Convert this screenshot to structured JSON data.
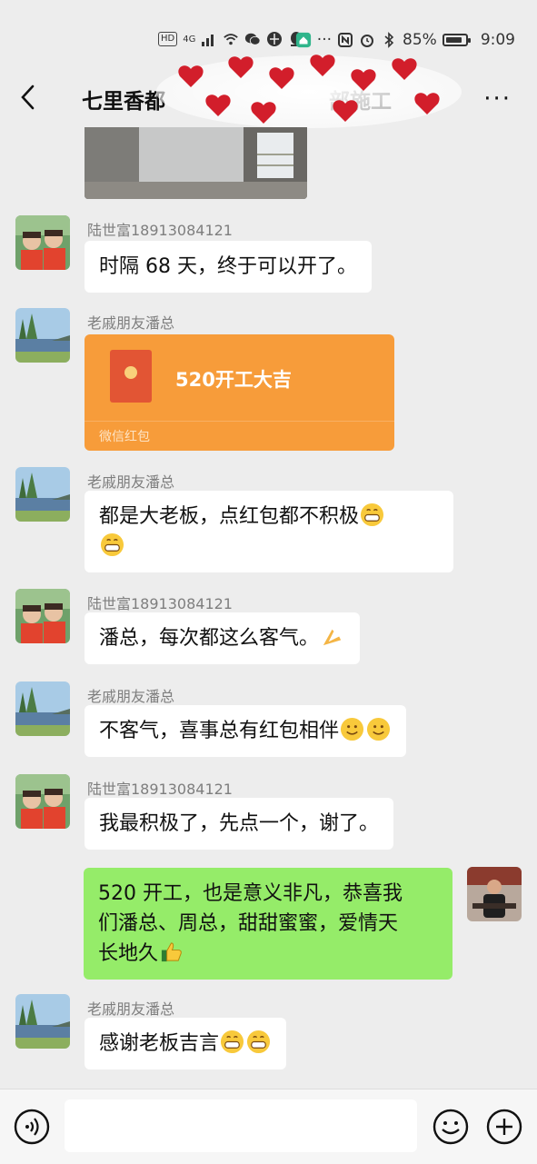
{
  "status_bar": {
    "network": "4G",
    "hd": "HD",
    "battery_percent": "85%",
    "battery_level": 0.85,
    "time": "9:09"
  },
  "nav": {
    "title": "七里香都",
    "title_tail": "部施工",
    "back_icon": "chevron-left-icon",
    "more_icon": "more-dots-icon"
  },
  "messages": [
    {
      "sender": "陆世富18913084121",
      "text": "时隔 68 天，终于可以开了。"
    },
    {
      "sender": "老戚朋友潘总",
      "type": "red_packet",
      "title": "520开工大吉",
      "label": "微信红包"
    },
    {
      "sender": "老戚朋友潘总",
      "text_line1": "都是大老板，点红包都不积极",
      "emoji": "grinning-emoji"
    },
    {
      "sender": "陆世富18913084121",
      "text": "潘总，每次都这么客气。",
      "emoji": "praying-hands-emoji"
    },
    {
      "sender": "老戚朋友潘总",
      "text": "不客气，喜事总有红包相伴",
      "emoji": "smile-emoji"
    },
    {
      "sender": "陆世富18913084121",
      "text": "我最积极了，先点一个，谢了。"
    },
    {
      "sender": "me",
      "line1": "520 开工，也是意义非凡，恭喜我",
      "line2": "们潘总、周总，甜甜蜜蜜，爱情天",
      "line3": "长地久",
      "emoji": "thumbs-up-emoji"
    },
    {
      "sender": "老戚朋友潘总",
      "text": "感谢老板吉言",
      "emoji": "grinning-emoji"
    }
  ],
  "input_bar": {
    "voice_icon": "voice-icon",
    "emoji_icon": "emoji-icon",
    "plus_icon": "plus-icon"
  },
  "colors": {
    "background": "#ededed",
    "my_bubble": "#95ec69",
    "red_packet": "#f79c3a"
  }
}
